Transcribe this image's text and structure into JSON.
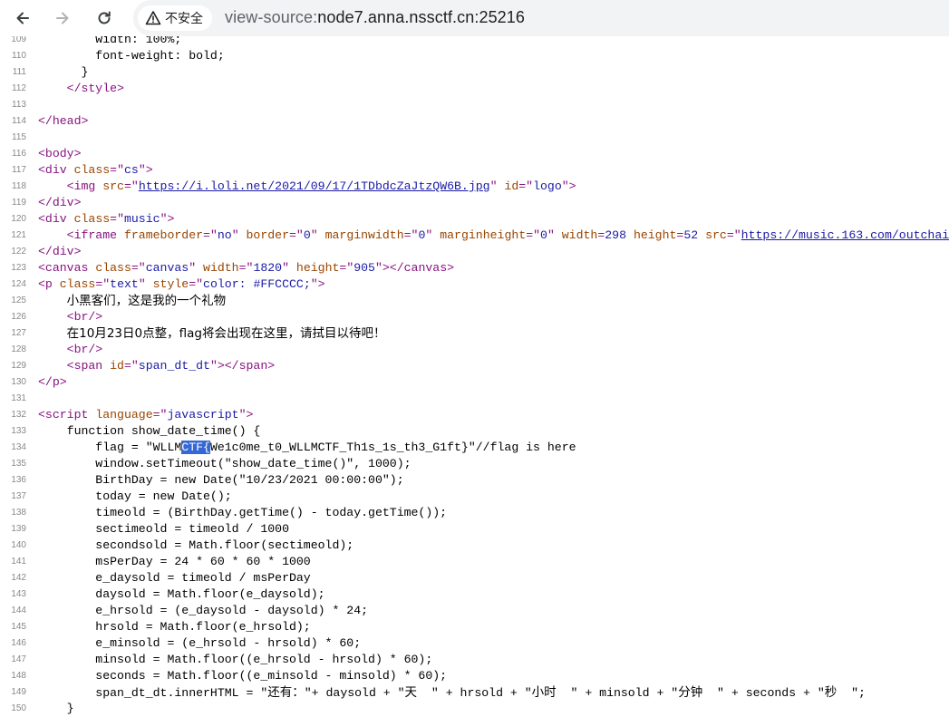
{
  "browser": {
    "back_icon": "arrow-left-icon",
    "forward_icon": "arrow-right-icon",
    "reload_icon": "reload-icon",
    "security_icon": "warning-triangle-icon",
    "security_label": "不安全",
    "url_prefix": "view-source:",
    "url_host": "node7.anna.nssctf.cn:25216"
  },
  "lines": [
    {
      "n": "109",
      "t": [
        [
          "txt",
          "        width: 100%;"
        ]
      ]
    },
    {
      "n": "110",
      "t": [
        [
          "txt",
          "        font-weight: bold;"
        ]
      ]
    },
    {
      "n": "111",
      "t": [
        [
          "txt",
          "      }"
        ]
      ]
    },
    {
      "n": "112",
      "t": [
        [
          "txt",
          "    "
        ],
        [
          "tag",
          "</style>"
        ]
      ]
    },
    {
      "n": "113",
      "t": []
    },
    {
      "n": "114",
      "t": [
        [
          "tag",
          "</head>"
        ]
      ]
    },
    {
      "n": "115",
      "t": []
    },
    {
      "n": "116",
      "t": [
        [
          "tag",
          "<body>"
        ]
      ]
    },
    {
      "n": "117",
      "t": [
        [
          "tag",
          "<div "
        ],
        [
          "attr",
          "class"
        ],
        [
          "tag",
          "=\""
        ],
        [
          "val",
          "cs"
        ],
        [
          "tag",
          "\">"
        ]
      ]
    },
    {
      "n": "118",
      "t": [
        [
          "txt",
          "    "
        ],
        [
          "tag",
          "<img "
        ],
        [
          "attr",
          "src"
        ],
        [
          "tag",
          "=\""
        ],
        [
          "link",
          "https://i.loli.net/2021/09/17/1TDbdcZaJtzQW6B.jpg"
        ],
        [
          "tag",
          "\" "
        ],
        [
          "attr",
          "id"
        ],
        [
          "tag",
          "=\""
        ],
        [
          "val",
          "logo"
        ],
        [
          "tag",
          "\">"
        ]
      ]
    },
    {
      "n": "119",
      "t": [
        [
          "tag",
          "</div>"
        ]
      ]
    },
    {
      "n": "120",
      "t": [
        [
          "tag",
          "<div "
        ],
        [
          "attr",
          "class"
        ],
        [
          "tag",
          "=\""
        ],
        [
          "val",
          "music"
        ],
        [
          "tag",
          "\">"
        ]
      ]
    },
    {
      "n": "121",
      "t": [
        [
          "txt",
          "    "
        ],
        [
          "tag",
          "<iframe "
        ],
        [
          "attr",
          "frameborder"
        ],
        [
          "tag",
          "=\""
        ],
        [
          "val",
          "no"
        ],
        [
          "tag",
          "\" "
        ],
        [
          "attr",
          "border"
        ],
        [
          "tag",
          "=\""
        ],
        [
          "val",
          "0"
        ],
        [
          "tag",
          "\" "
        ],
        [
          "attr",
          "marginwidth"
        ],
        [
          "tag",
          "=\""
        ],
        [
          "val",
          "0"
        ],
        [
          "tag",
          "\" "
        ],
        [
          "attr",
          "marginheight"
        ],
        [
          "tag",
          "=\""
        ],
        [
          "val",
          "0"
        ],
        [
          "tag",
          "\" "
        ],
        [
          "attr",
          "width"
        ],
        [
          "tag",
          "="
        ],
        [
          "val",
          "298"
        ],
        [
          "tag",
          " "
        ],
        [
          "attr",
          "height"
        ],
        [
          "tag",
          "="
        ],
        [
          "val",
          "52"
        ],
        [
          "tag",
          " "
        ],
        [
          "attr",
          "src"
        ],
        [
          "tag",
          "=\""
        ],
        [
          "link",
          "https://music.163.com/outchain"
        ]
      ]
    },
    {
      "n": "122",
      "t": [
        [
          "tag",
          "</div>"
        ]
      ]
    },
    {
      "n": "123",
      "t": [
        [
          "tag",
          "<canvas "
        ],
        [
          "attr",
          "class"
        ],
        [
          "tag",
          "=\""
        ],
        [
          "val",
          "canvas"
        ],
        [
          "tag",
          "\" "
        ],
        [
          "attr",
          "width"
        ],
        [
          "tag",
          "=\""
        ],
        [
          "val",
          "1820"
        ],
        [
          "tag",
          "\" "
        ],
        [
          "attr",
          "height"
        ],
        [
          "tag",
          "=\""
        ],
        [
          "val",
          "905"
        ],
        [
          "tag",
          "\"></canvas>"
        ]
      ]
    },
    {
      "n": "124",
      "t": [
        [
          "tag",
          "<p "
        ],
        [
          "attr",
          "class"
        ],
        [
          "tag",
          "=\""
        ],
        [
          "val",
          "text"
        ],
        [
          "tag",
          "\" "
        ],
        [
          "attr",
          "style"
        ],
        [
          "tag",
          "=\""
        ],
        [
          "val",
          "color: #FFCCCC;"
        ],
        [
          "tag",
          "\">"
        ]
      ]
    },
    {
      "n": "125",
      "t": [
        [
          "txt",
          "    "
        ],
        [
          "cn",
          "小黑客们，这是我的一个礼物"
        ]
      ]
    },
    {
      "n": "126",
      "t": [
        [
          "txt",
          "    "
        ],
        [
          "tag",
          "<br/>"
        ]
      ]
    },
    {
      "n": "127",
      "t": [
        [
          "txt",
          "    "
        ],
        [
          "cn",
          "在10月23日0点整，flag将会出现在这里，请拭目以待吧！"
        ]
      ]
    },
    {
      "n": "128",
      "t": [
        [
          "txt",
          "    "
        ],
        [
          "tag",
          "<br/>"
        ]
      ]
    },
    {
      "n": "129",
      "t": [
        [
          "txt",
          "    "
        ],
        [
          "tag",
          "<span "
        ],
        [
          "attr",
          "id"
        ],
        [
          "tag",
          "=\""
        ],
        [
          "val",
          "span_dt_dt"
        ],
        [
          "tag",
          "\"></span>"
        ]
      ]
    },
    {
      "n": "130",
      "t": [
        [
          "tag",
          "</p>"
        ]
      ]
    },
    {
      "n": "131",
      "t": []
    },
    {
      "n": "132",
      "t": [
        [
          "tag",
          "<script "
        ],
        [
          "attr",
          "language"
        ],
        [
          "tag",
          "=\""
        ],
        [
          "val",
          "javascript"
        ],
        [
          "tag",
          "\">"
        ]
      ]
    },
    {
      "n": "133",
      "t": [
        [
          "txt",
          "    function show_date_time() {"
        ]
      ]
    },
    {
      "n": "134",
      "t": [
        [
          "txt",
          "        flag = \"WLLM"
        ],
        [
          "hl",
          "CTF{"
        ],
        [
          "txt",
          "We1c0me_t0_WLLMCTF_Th1s_1s_th3_G1ft}\"//flag is here"
        ]
      ]
    },
    {
      "n": "135",
      "t": [
        [
          "txt",
          "        window.setTimeout(\"show_date_time()\", 1000);"
        ]
      ]
    },
    {
      "n": "136",
      "t": [
        [
          "txt",
          "        BirthDay = new Date(\"10/23/2021 00:00:00\");"
        ]
      ]
    },
    {
      "n": "137",
      "t": [
        [
          "txt",
          "        today = new Date();"
        ]
      ]
    },
    {
      "n": "138",
      "t": [
        [
          "txt",
          "        timeold = (BirthDay.getTime() - today.getTime());"
        ]
      ]
    },
    {
      "n": "139",
      "t": [
        [
          "txt",
          "        sectimeold = timeold / 1000"
        ]
      ]
    },
    {
      "n": "140",
      "t": [
        [
          "txt",
          "        secondsold = Math.floor(sectimeold);"
        ]
      ]
    },
    {
      "n": "141",
      "t": [
        [
          "txt",
          "        msPerDay = 24 * 60 * 60 * 1000"
        ]
      ]
    },
    {
      "n": "142",
      "t": [
        [
          "txt",
          "        e_daysold = timeold / msPerDay"
        ]
      ]
    },
    {
      "n": "143",
      "t": [
        [
          "txt",
          "        daysold = Math.floor(e_daysold);"
        ]
      ]
    },
    {
      "n": "144",
      "t": [
        [
          "txt",
          "        e_hrsold = (e_daysold - daysold) * 24;"
        ]
      ]
    },
    {
      "n": "145",
      "t": [
        [
          "txt",
          "        hrsold = Math.floor(e_hrsold);"
        ]
      ]
    },
    {
      "n": "146",
      "t": [
        [
          "txt",
          "        e_minsold = (e_hrsold - hrsold) * 60;"
        ]
      ]
    },
    {
      "n": "147",
      "t": [
        [
          "txt",
          "        minsold = Math.floor((e_hrsold - hrsold) * 60);"
        ]
      ]
    },
    {
      "n": "148",
      "t": [
        [
          "txt",
          "        seconds = Math.floor((e_minsold - minsold) * 60);"
        ]
      ]
    },
    {
      "n": "149",
      "t": [
        [
          "txt",
          "        span_dt_dt.innerHTML = \""
        ],
        [
          "cn",
          "还有："
        ],
        [
          "txt",
          "\"+ daysold + \""
        ],
        [
          "cn",
          "天"
        ],
        [
          "txt",
          "  \" + hrsold + \""
        ],
        [
          "cn",
          "小时"
        ],
        [
          "txt",
          "  \" + minsold + \""
        ],
        [
          "cn",
          "分钟"
        ],
        [
          "txt",
          "  \" + seconds + \""
        ],
        [
          "cn",
          "秒"
        ],
        [
          "txt",
          "  \";"
        ]
      ]
    },
    {
      "n": "150",
      "t": [
        [
          "txt",
          "    }"
        ]
      ]
    }
  ]
}
